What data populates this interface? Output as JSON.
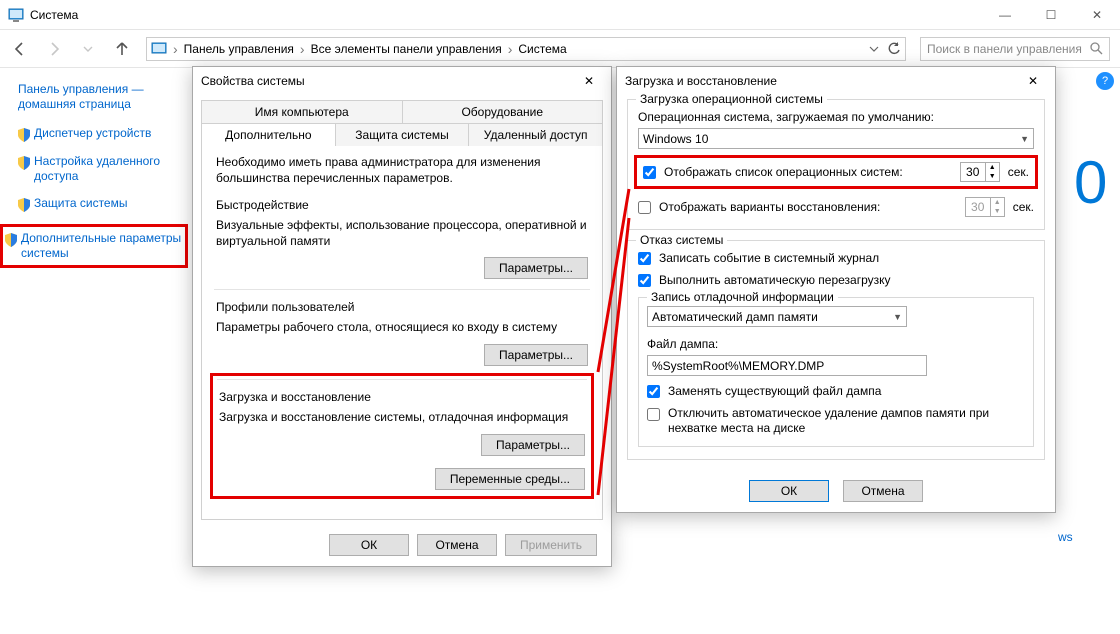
{
  "window": {
    "title": "Система",
    "minimize": "—",
    "maximize": "☐",
    "close": "✕"
  },
  "navbar": {
    "crumbs": [
      "Панель управления",
      "Все элементы панели управления",
      "Система"
    ],
    "search_placeholder": "Поиск в панели управления"
  },
  "sidepanel": {
    "home": "Панель управления — домашняя страница",
    "items": [
      "Диспетчер устройств",
      "Настройка удаленного доступа",
      "Защита системы",
      "Дополнительные параметры системы"
    ]
  },
  "dlg1": {
    "title": "Свойства системы",
    "tabs_row1": [
      "Имя компьютера",
      "Оборудование"
    ],
    "tabs_row2": [
      "Дополнительно",
      "Защита системы",
      "Удаленный доступ"
    ],
    "admin_note": "Необходимо иметь права администратора для изменения большинства перечисленных параметров.",
    "perf_title": "Быстродействие",
    "perf_desc": "Визуальные эффекты, использование процессора, оперативной и виртуальной памяти",
    "btn_params": "Параметры...",
    "profiles_title": "Профили пользователей",
    "profiles_desc": "Параметры рабочего стола, относящиеся ко входу в систему",
    "boot_title": "Загрузка и восстановление",
    "boot_desc": "Загрузка и восстановление системы, отладочная информация",
    "btn_env": "Переменные среды...",
    "btn_ok": "ОК",
    "btn_cancel": "Отмена",
    "btn_apply": "Применить"
  },
  "dlg2": {
    "title": "Загрузка и восстановление",
    "fs1_title": "Загрузка операционной системы",
    "os_label": "Операционная система, загружаемая по умолчанию:",
    "os_value": "Windows 10",
    "opt_oslist": "Отображать список операционных систем:",
    "opt_oslist_val": "30",
    "opt_recovery": "Отображать варианты восстановления:",
    "opt_recovery_val": "30",
    "sec_unit": "сек.",
    "fs2_title": "Отказ системы",
    "chk_log": "Записать событие в системный журнал",
    "chk_reboot": "Выполнить автоматическую перезагрузку",
    "dump_title": "Запись отладочной информации",
    "dump_combo": "Автоматический дамп памяти",
    "dump_file_label": "Файл дампа:",
    "dump_file_value": "%SystemRoot%\\MEMORY.DMP",
    "chk_overwrite": "Заменять существующий файл дампа",
    "chk_nodelete": "Отключить автоматическое удаление дампов памяти при нехватке места на диске",
    "btn_ok": "ОК",
    "btn_cancel": "Отмена"
  }
}
